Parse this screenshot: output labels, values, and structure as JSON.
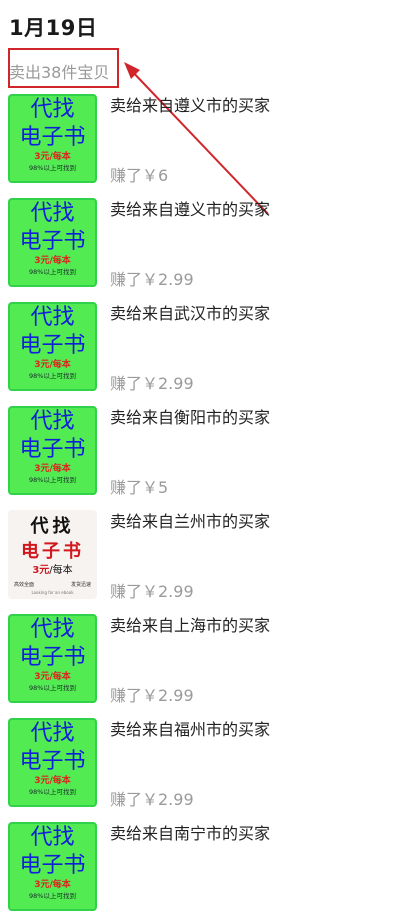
{
  "date_header": "1月19日",
  "summary": "卖出38件宝贝",
  "colors": {
    "annotation_red": "#d0262b",
    "thumb_green": "#52ec52",
    "thumb_blue_text": "#1020d8"
  },
  "thumb_green": {
    "line1": "代找",
    "line2": "电子书",
    "price": "3元/每本",
    "note": "98%以上可找到"
  },
  "thumb_white": {
    "line1": "代找",
    "line2": "电子书",
    "price_red": "3元",
    "price_rest": "/每本",
    "left_tag": "高效全面",
    "right_tag": "发货迅速",
    "footer": "Looking for an ebook"
  },
  "items": [
    {
      "title": "卖给来自遵义市的买家",
      "earned": "赚了￥6"
    },
    {
      "title": "卖给来自遵义市的买家",
      "earned": "赚了￥2.99"
    },
    {
      "title": "卖给来自武汉市的买家",
      "earned": "赚了￥2.99"
    },
    {
      "title": "卖给来自衡阳市的买家",
      "earned": "赚了￥5"
    },
    {
      "title": "卖给来自兰州市的买家",
      "earned": "赚了￥2.99"
    },
    {
      "title": "卖给来自上海市的买家",
      "earned": "赚了￥2.99"
    },
    {
      "title": "卖给来自福州市的买家",
      "earned": "赚了￥2.99"
    },
    {
      "title": "卖给来自南宁市的买家",
      "earned": ""
    }
  ]
}
